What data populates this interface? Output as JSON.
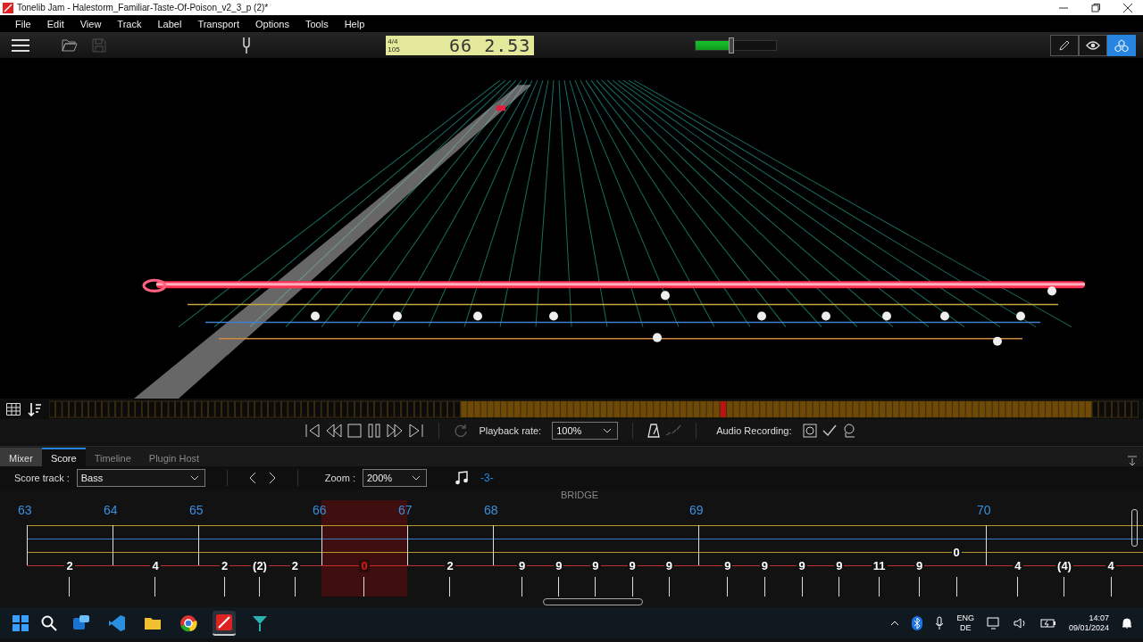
{
  "window": {
    "title": "Tonelib Jam - Halestorm_Familiar-Taste-Of-Poison_v2_3_p (2)*"
  },
  "menu": [
    "File",
    "Edit",
    "View",
    "Track",
    "Label",
    "Transport",
    "Options",
    "Tools",
    "Help"
  ],
  "toolbar": {
    "save_disabled": true,
    "display": {
      "time_signature": "4/4",
      "tempo": "105",
      "position": "66 2.53"
    },
    "volume": {
      "level": 0.45
    },
    "view_modes": [
      {
        "kind": "edit",
        "selected": false
      },
      {
        "kind": "view",
        "selected": false
      },
      {
        "kind": "cubes",
        "selected": true
      }
    ]
  },
  "transport": {
    "loop_disabled": true,
    "playback_rate_label": "Playback rate:",
    "playback_rate": "100%",
    "count_in_disabled": true,
    "audio_recording_label": "Audio Recording:"
  },
  "tabs": [
    {
      "label": "Mixer",
      "selected": false
    },
    {
      "label": "Score",
      "selected": true
    },
    {
      "label": "Timeline",
      "selected": false
    },
    {
      "label": "Plugin Host",
      "selected": false
    }
  ],
  "score_toolbar": {
    "track_label": "Score track :",
    "track": "Bass",
    "zoom_label": "Zoom :",
    "zoom": "200%",
    "tuplet": "-3-"
  },
  "score": {
    "section": "BRIDGE",
    "measures": [
      {
        "number": "63",
        "current": false,
        "e_string_notes": [
          "2"
        ]
      },
      {
        "number": "64",
        "current": false,
        "e_string_notes": [
          "4"
        ]
      },
      {
        "number": "65",
        "current": false,
        "e_string_notes": [
          "2",
          "(2)",
          "2"
        ]
      },
      {
        "number": "66",
        "current": true,
        "e_string_notes": [
          "0"
        ]
      },
      {
        "number": "67",
        "current": false,
        "e_string_notes": [
          "2"
        ]
      },
      {
        "number": "68",
        "current": false,
        "e_string_notes": [
          "9",
          "9",
          "9",
          "9",
          "9"
        ]
      },
      {
        "number": "69",
        "current": false,
        "e_string_notes": [
          "9",
          "9",
          "9",
          "9",
          "11",
          "9"
        ],
        "a_string_notes": [
          "0"
        ]
      },
      {
        "number": "70",
        "current": false,
        "e_string_notes": [
          "4",
          "(4)",
          "4"
        ]
      }
    ]
  },
  "taskbar": {
    "apps": [
      {
        "kind": "mail",
        "active": false
      },
      {
        "kind": "code",
        "active": false
      },
      {
        "kind": "folder",
        "active": false
      },
      {
        "kind": "browser",
        "active": false
      },
      {
        "kind": "guitar",
        "active": true
      },
      {
        "kind": "flag",
        "active": false
      }
    ],
    "language": "ENG",
    "layout": "DE",
    "time": "14:07",
    "date": "09/01/2024"
  }
}
